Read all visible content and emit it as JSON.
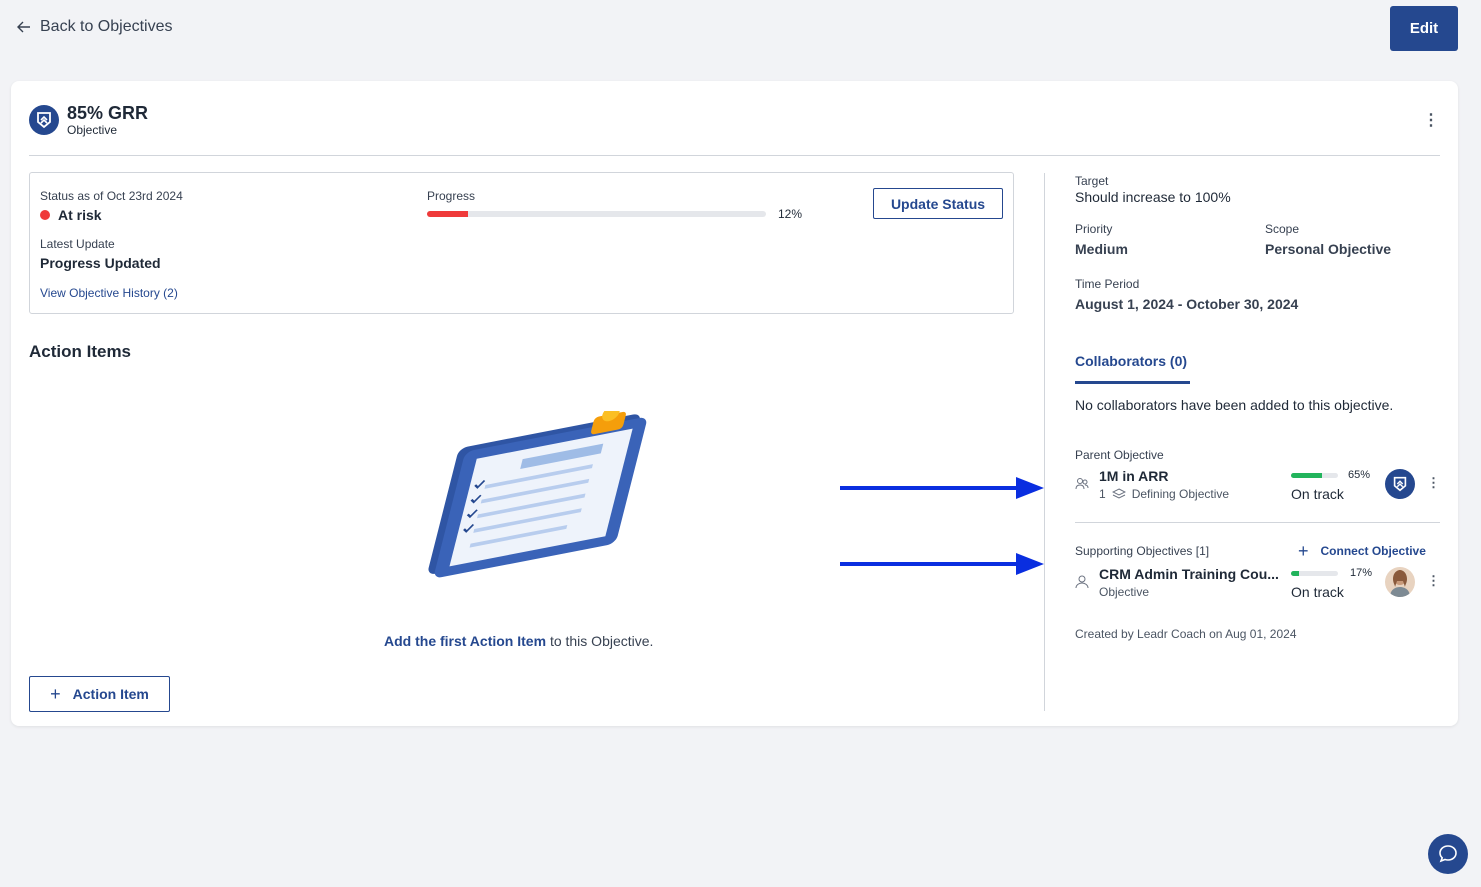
{
  "nav": {
    "back_label": "Back to Objectives",
    "edit_label": "Edit"
  },
  "objective": {
    "title": "85% GRR",
    "type": "Objective"
  },
  "status": {
    "label": "Status as of Oct 23rd 2024",
    "value": "At risk",
    "color": "#ef3a3a",
    "latest_update_label": "Latest Update",
    "latest_update_value": "Progress Updated",
    "history_link": "View Objective History (2)",
    "progress_label": "Progress",
    "progress_pct": "12%",
    "progress_value": 0.12,
    "update_button": "Update Status"
  },
  "action_items": {
    "title": "Action Items",
    "empty_link": "Add the first Action Item",
    "empty_suffix": "to this Objective.",
    "add_button": "Action Item"
  },
  "details": {
    "target_label": "Target",
    "target_value": "Should increase to 100%",
    "priority_label": "Priority",
    "priority_value": "Medium",
    "scope_label": "Scope",
    "scope_value": "Personal Objective",
    "time_label": "Time Period",
    "time_value": "August 1, 2024 - October 30, 2024"
  },
  "collaborators": {
    "tab": "Collaborators (0)",
    "empty": "No collaborators have been added to this objective."
  },
  "parent": {
    "label": "Parent Objective",
    "title": "1M in ARR",
    "count": "1",
    "sub": "Defining Objective",
    "pct": "65%",
    "progress_value": 0.65,
    "status": "On track"
  },
  "supporting": {
    "label": "Supporting Objectives [1]",
    "connect": "Connect Objective",
    "title": "CRM Admin Training Cou...",
    "sub": "Objective",
    "pct": "17%",
    "progress_value": 0.17,
    "status": "On track"
  },
  "created": "Created by Leadr Coach on Aug 01, 2024",
  "colors": {
    "brand": "#25488f",
    "at_risk": "#ef3a3a",
    "on_track": "#22b45c",
    "arrow": "#0a2ee0"
  }
}
